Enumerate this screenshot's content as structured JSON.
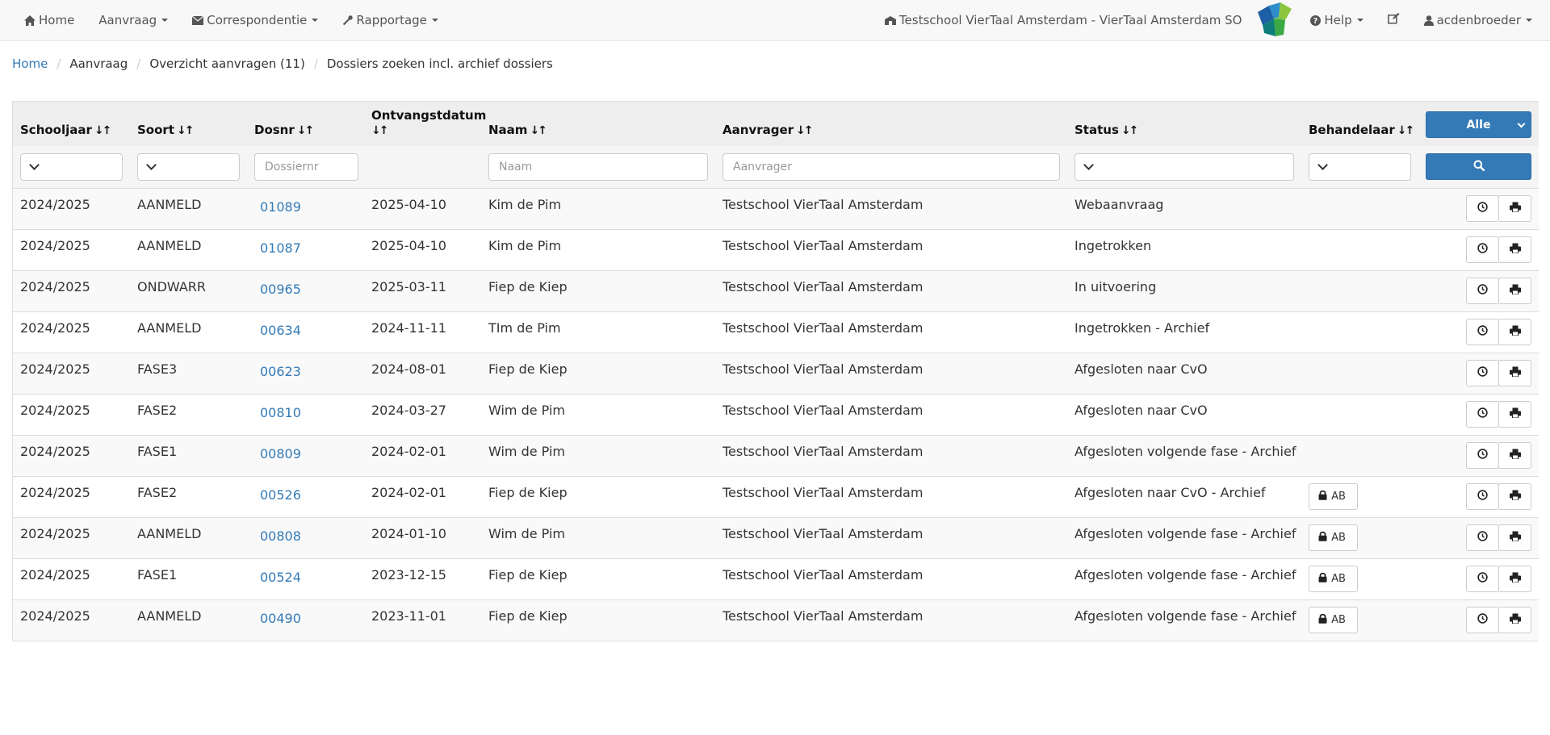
{
  "nav": {
    "home": "Home",
    "aanvraag": "Aanvraag",
    "correspondentie": "Correspondentie",
    "rapportage": "Rapportage",
    "school": "Testschool VierTaal Amsterdam - VierTaal Amsterdam SO",
    "help": "Help",
    "user": "acdenbroeder"
  },
  "breadcrumb": {
    "home": "Home",
    "aanvraag": "Aanvraag",
    "overzicht": "Overzicht aanvragen (11)",
    "current": "Dossiers zoeken incl. archief dossiers"
  },
  "table": {
    "headers": {
      "schooljaar": "Schooljaar",
      "soort": "Soort",
      "dosnr": "Dosnr",
      "ontvangstdatum": "Ontvangstdatum",
      "naam": "Naam",
      "aanvrager": "Aanvrager",
      "status": "Status",
      "behandelaar": "Behandelaar"
    },
    "alle_label": "Alle",
    "filters": {
      "dossiernr_placeholder": "Dossiernr",
      "naam_placeholder": "Naam",
      "aanvrager_placeholder": "Aanvrager"
    },
    "rows": [
      {
        "schooljaar": "2024/2025",
        "soort": "AANMELD",
        "dosnr": "01089",
        "datum": "2025-04-10",
        "naam": "Kim de Pim",
        "aanvrager": "Testschool VierTaal Amsterdam",
        "status": "Webaanvraag",
        "behandelaar": ""
      },
      {
        "schooljaar": "2024/2025",
        "soort": "AANMELD",
        "dosnr": "01087",
        "datum": "2025-04-10",
        "naam": "Kim de Pim",
        "aanvrager": "Testschool VierTaal Amsterdam",
        "status": "Ingetrokken",
        "behandelaar": ""
      },
      {
        "schooljaar": "2024/2025",
        "soort": "ONDWARR",
        "dosnr": "00965",
        "datum": "2025-03-11",
        "naam": "Fiep de Kiep",
        "aanvrager": "Testschool VierTaal Amsterdam",
        "status": "In uitvoering",
        "behandelaar": ""
      },
      {
        "schooljaar": "2024/2025",
        "soort": "AANMELD",
        "dosnr": "00634",
        "datum": "2024-11-11",
        "naam": "TIm de Pim",
        "aanvrager": "Testschool VierTaal Amsterdam",
        "status": "Ingetrokken - Archief",
        "behandelaar": ""
      },
      {
        "schooljaar": "2024/2025",
        "soort": "FASE3",
        "dosnr": "00623",
        "datum": "2024-08-01",
        "naam": "Fiep de Kiep",
        "aanvrager": "Testschool VierTaal Amsterdam",
        "status": "Afgesloten naar CvO",
        "behandelaar": ""
      },
      {
        "schooljaar": "2024/2025",
        "soort": "FASE2",
        "dosnr": "00810",
        "datum": "2024-03-27",
        "naam": "Wim de Pim",
        "aanvrager": "Testschool VierTaal Amsterdam",
        "status": "Afgesloten naar CvO",
        "behandelaar": ""
      },
      {
        "schooljaar": "2024/2025",
        "soort": "FASE1",
        "dosnr": "00809",
        "datum": "2024-02-01",
        "naam": "Wim de Pim",
        "aanvrager": "Testschool VierTaal Amsterdam",
        "status": "Afgesloten volgende fase - Archief",
        "behandelaar": ""
      },
      {
        "schooljaar": "2024/2025",
        "soort": "FASE2",
        "dosnr": "00526",
        "datum": "2024-02-01",
        "naam": "Fiep de Kiep",
        "aanvrager": "Testschool VierTaal Amsterdam",
        "status": "Afgesloten naar CvO - Archief",
        "behandelaar": "AB"
      },
      {
        "schooljaar": "2024/2025",
        "soort": "AANMELD",
        "dosnr": "00808",
        "datum": "2024-01-10",
        "naam": "Wim de Pim",
        "aanvrager": "Testschool VierTaal Amsterdam",
        "status": "Afgesloten volgende fase - Archief",
        "behandelaar": "AB"
      },
      {
        "schooljaar": "2024/2025",
        "soort": "FASE1",
        "dosnr": "00524",
        "datum": "2023-12-15",
        "naam": "Fiep de Kiep",
        "aanvrager": "Testschool VierTaal Amsterdam",
        "status": "Afgesloten volgende fase - Archief",
        "behandelaar": "AB"
      },
      {
        "schooljaar": "2024/2025",
        "soort": "AANMELD",
        "dosnr": "00490",
        "datum": "2023-11-01",
        "naam": "Fiep de Kiep",
        "aanvrager": "Testschool VierTaal Amsterdam",
        "status": "Afgesloten volgende fase - Archief",
        "behandelaar": "AB"
      }
    ]
  },
  "icons": {
    "home": "home-icon",
    "correspondentie": "envelope-icon",
    "rapportage": "wrench-icon",
    "school": "building-icon",
    "help": "question-circle-icon",
    "edit": "edit-icon",
    "user": "user-icon",
    "search": "search-icon",
    "history": "clock-icon",
    "print": "print-icon",
    "lock": "lock-icon"
  },
  "colors": {
    "link": "#337ab7",
    "primary": "#337ab7",
    "navbar_bg": "#f8f8f8",
    "header_bg": "#eeeeee"
  }
}
